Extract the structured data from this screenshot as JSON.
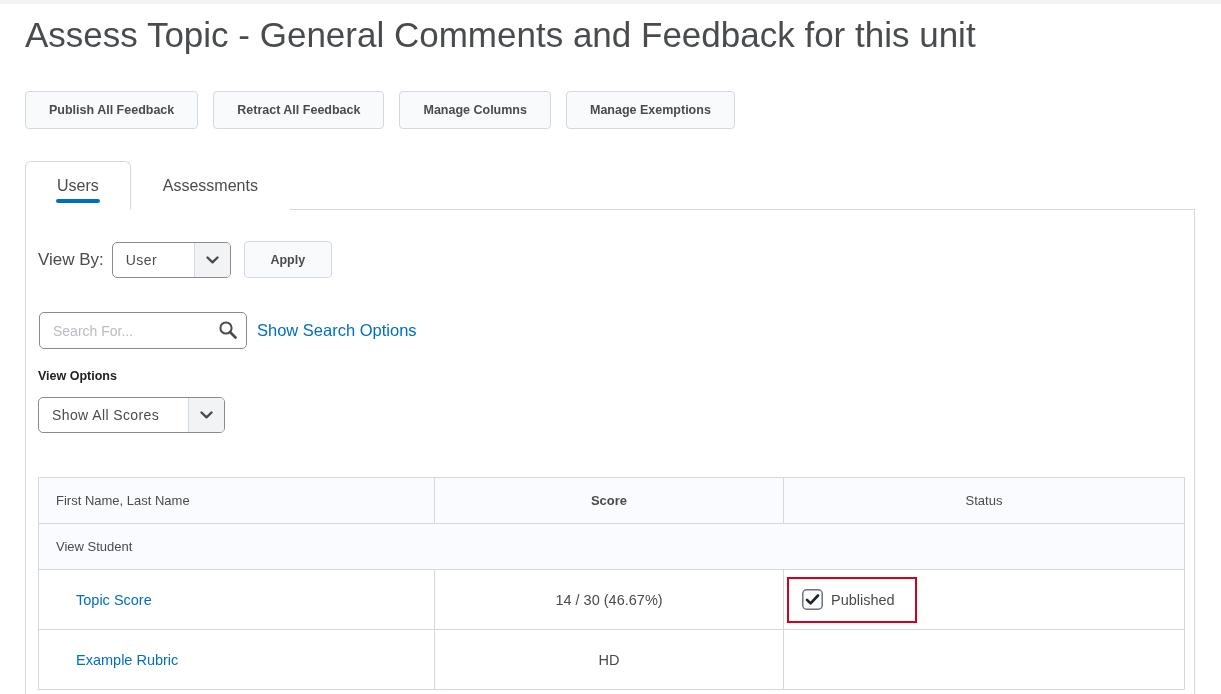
{
  "page": {
    "title": "Assess Topic - General Comments and Feedback for this unit"
  },
  "toolbar": {
    "buttons": [
      "Publish All Feedback",
      "Retract All Feedback",
      "Manage Columns",
      "Manage Exemptions"
    ]
  },
  "tabs": [
    {
      "label": "Users",
      "selected": true
    },
    {
      "label": "Assessments",
      "selected": false
    }
  ],
  "view_by": {
    "label": "View By:",
    "value": "User",
    "apply_button": "Apply"
  },
  "search": {
    "placeholder": "Search For...",
    "options_link": "Show Search Options"
  },
  "view_options": {
    "label": "View Options",
    "value": "Show All Scores"
  },
  "table": {
    "columns": [
      {
        "label": "First Name, Last Name",
        "sorted": false
      },
      {
        "label": "Score",
        "sorted": true
      },
      {
        "label": "Status",
        "sorted": false
      }
    ],
    "rows": [
      {
        "kind": "group",
        "label": "View Student"
      },
      {
        "kind": "item",
        "name": "Topic Score",
        "score": "14 / 30 (46.67%)",
        "status": {
          "label": "Published",
          "checked": true,
          "highlighted": true
        }
      },
      {
        "kind": "item",
        "name": "Example Rubric",
        "score": "HD"
      }
    ]
  }
}
